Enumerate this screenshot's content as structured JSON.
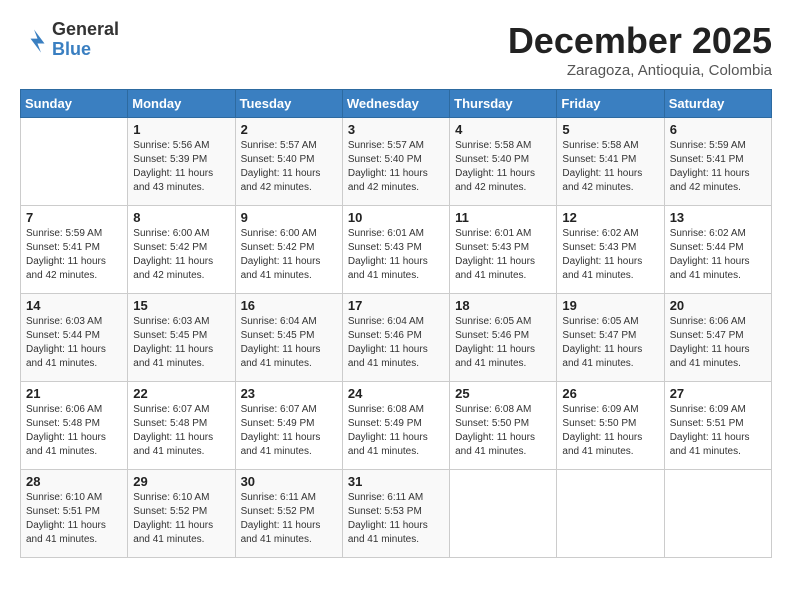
{
  "logo": {
    "general": "General",
    "blue": "Blue"
  },
  "title": "December 2025",
  "subtitle": "Zaragoza, Antioquia, Colombia",
  "days_of_week": [
    "Sunday",
    "Monday",
    "Tuesday",
    "Wednesday",
    "Thursday",
    "Friday",
    "Saturday"
  ],
  "weeks": [
    [
      {
        "day": "",
        "sunrise": "",
        "sunset": "",
        "daylight": ""
      },
      {
        "day": "1",
        "sunrise": "Sunrise: 5:56 AM",
        "sunset": "Sunset: 5:39 PM",
        "daylight": "Daylight: 11 hours and 43 minutes."
      },
      {
        "day": "2",
        "sunrise": "Sunrise: 5:57 AM",
        "sunset": "Sunset: 5:40 PM",
        "daylight": "Daylight: 11 hours and 42 minutes."
      },
      {
        "day": "3",
        "sunrise": "Sunrise: 5:57 AM",
        "sunset": "Sunset: 5:40 PM",
        "daylight": "Daylight: 11 hours and 42 minutes."
      },
      {
        "day": "4",
        "sunrise": "Sunrise: 5:58 AM",
        "sunset": "Sunset: 5:40 PM",
        "daylight": "Daylight: 11 hours and 42 minutes."
      },
      {
        "day": "5",
        "sunrise": "Sunrise: 5:58 AM",
        "sunset": "Sunset: 5:41 PM",
        "daylight": "Daylight: 11 hours and 42 minutes."
      },
      {
        "day": "6",
        "sunrise": "Sunrise: 5:59 AM",
        "sunset": "Sunset: 5:41 PM",
        "daylight": "Daylight: 11 hours and 42 minutes."
      }
    ],
    [
      {
        "day": "7",
        "sunrise": "Sunrise: 5:59 AM",
        "sunset": "Sunset: 5:41 PM",
        "daylight": "Daylight: 11 hours and 42 minutes."
      },
      {
        "day": "8",
        "sunrise": "Sunrise: 6:00 AM",
        "sunset": "Sunset: 5:42 PM",
        "daylight": "Daylight: 11 hours and 42 minutes."
      },
      {
        "day": "9",
        "sunrise": "Sunrise: 6:00 AM",
        "sunset": "Sunset: 5:42 PM",
        "daylight": "Daylight: 11 hours and 41 minutes."
      },
      {
        "day": "10",
        "sunrise": "Sunrise: 6:01 AM",
        "sunset": "Sunset: 5:43 PM",
        "daylight": "Daylight: 11 hours and 41 minutes."
      },
      {
        "day": "11",
        "sunrise": "Sunrise: 6:01 AM",
        "sunset": "Sunset: 5:43 PM",
        "daylight": "Daylight: 11 hours and 41 minutes."
      },
      {
        "day": "12",
        "sunrise": "Sunrise: 6:02 AM",
        "sunset": "Sunset: 5:43 PM",
        "daylight": "Daylight: 11 hours and 41 minutes."
      },
      {
        "day": "13",
        "sunrise": "Sunrise: 6:02 AM",
        "sunset": "Sunset: 5:44 PM",
        "daylight": "Daylight: 11 hours and 41 minutes."
      }
    ],
    [
      {
        "day": "14",
        "sunrise": "Sunrise: 6:03 AM",
        "sunset": "Sunset: 5:44 PM",
        "daylight": "Daylight: 11 hours and 41 minutes."
      },
      {
        "day": "15",
        "sunrise": "Sunrise: 6:03 AM",
        "sunset": "Sunset: 5:45 PM",
        "daylight": "Daylight: 11 hours and 41 minutes."
      },
      {
        "day": "16",
        "sunrise": "Sunrise: 6:04 AM",
        "sunset": "Sunset: 5:45 PM",
        "daylight": "Daylight: 11 hours and 41 minutes."
      },
      {
        "day": "17",
        "sunrise": "Sunrise: 6:04 AM",
        "sunset": "Sunset: 5:46 PM",
        "daylight": "Daylight: 11 hours and 41 minutes."
      },
      {
        "day": "18",
        "sunrise": "Sunrise: 6:05 AM",
        "sunset": "Sunset: 5:46 PM",
        "daylight": "Daylight: 11 hours and 41 minutes."
      },
      {
        "day": "19",
        "sunrise": "Sunrise: 6:05 AM",
        "sunset": "Sunset: 5:47 PM",
        "daylight": "Daylight: 11 hours and 41 minutes."
      },
      {
        "day": "20",
        "sunrise": "Sunrise: 6:06 AM",
        "sunset": "Sunset: 5:47 PM",
        "daylight": "Daylight: 11 hours and 41 minutes."
      }
    ],
    [
      {
        "day": "21",
        "sunrise": "Sunrise: 6:06 AM",
        "sunset": "Sunset: 5:48 PM",
        "daylight": "Daylight: 11 hours and 41 minutes."
      },
      {
        "day": "22",
        "sunrise": "Sunrise: 6:07 AM",
        "sunset": "Sunset: 5:48 PM",
        "daylight": "Daylight: 11 hours and 41 minutes."
      },
      {
        "day": "23",
        "sunrise": "Sunrise: 6:07 AM",
        "sunset": "Sunset: 5:49 PM",
        "daylight": "Daylight: 11 hours and 41 minutes."
      },
      {
        "day": "24",
        "sunrise": "Sunrise: 6:08 AM",
        "sunset": "Sunset: 5:49 PM",
        "daylight": "Daylight: 11 hours and 41 minutes."
      },
      {
        "day": "25",
        "sunrise": "Sunrise: 6:08 AM",
        "sunset": "Sunset: 5:50 PM",
        "daylight": "Daylight: 11 hours and 41 minutes."
      },
      {
        "day": "26",
        "sunrise": "Sunrise: 6:09 AM",
        "sunset": "Sunset: 5:50 PM",
        "daylight": "Daylight: 11 hours and 41 minutes."
      },
      {
        "day": "27",
        "sunrise": "Sunrise: 6:09 AM",
        "sunset": "Sunset: 5:51 PM",
        "daylight": "Daylight: 11 hours and 41 minutes."
      }
    ],
    [
      {
        "day": "28",
        "sunrise": "Sunrise: 6:10 AM",
        "sunset": "Sunset: 5:51 PM",
        "daylight": "Daylight: 11 hours and 41 minutes."
      },
      {
        "day": "29",
        "sunrise": "Sunrise: 6:10 AM",
        "sunset": "Sunset: 5:52 PM",
        "daylight": "Daylight: 11 hours and 41 minutes."
      },
      {
        "day": "30",
        "sunrise": "Sunrise: 6:11 AM",
        "sunset": "Sunset: 5:52 PM",
        "daylight": "Daylight: 11 hours and 41 minutes."
      },
      {
        "day": "31",
        "sunrise": "Sunrise: 6:11 AM",
        "sunset": "Sunset: 5:53 PM",
        "daylight": "Daylight: 11 hours and 41 minutes."
      },
      {
        "day": "",
        "sunrise": "",
        "sunset": "",
        "daylight": ""
      },
      {
        "day": "",
        "sunrise": "",
        "sunset": "",
        "daylight": ""
      },
      {
        "day": "",
        "sunrise": "",
        "sunset": "",
        "daylight": ""
      }
    ]
  ]
}
